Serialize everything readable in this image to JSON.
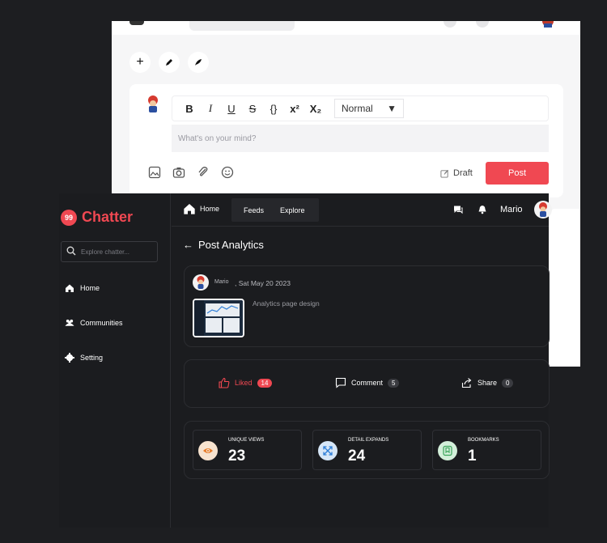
{
  "editor": {
    "toolbar": {
      "bold": "B",
      "italic": "I",
      "underline": "U",
      "strike": "S",
      "code": "{}",
      "superscript": "x²",
      "subscript": "X₂",
      "format_select": "Normal"
    },
    "placeholder": "What's on your mind?",
    "draft_label": "Draft",
    "post_label": "Post"
  },
  "app": {
    "logo_mark": "99",
    "logo_text": "Chatter",
    "accent": "#f04852",
    "search_placeholder": "Explore chatter...",
    "sidebar": [
      {
        "label": "Home",
        "icon": "home-icon"
      },
      {
        "label": "Communities",
        "icon": "users-icon"
      },
      {
        "label": "Setting",
        "icon": "gear-icon"
      }
    ],
    "topbar": {
      "home_label": "Home",
      "tabs": [
        "Feeds",
        "Explore"
      ],
      "username": "Mario"
    }
  },
  "post_analytics": {
    "title": "Post Analytics",
    "author": "Mario",
    "date": ", Sat May 20 2023",
    "caption": "Analytics page design",
    "reactions": {
      "liked_label": "Liked",
      "liked_count": "14",
      "comment_label": "Comment",
      "comment_count": "5",
      "share_label": "Share",
      "share_count": "0"
    },
    "metrics": [
      {
        "label": "UNIQUE VIEWS",
        "value": "23",
        "icon": "eye-icon",
        "color": "#e87d2a"
      },
      {
        "label": "DETAIL EXPANDS",
        "value": "24",
        "icon": "expand-icon",
        "color": "#2f7fd8"
      },
      {
        "label": "BOOKMARKS",
        "value": "1",
        "icon": "bookmark-icon",
        "color": "#3aa55a"
      }
    ]
  }
}
